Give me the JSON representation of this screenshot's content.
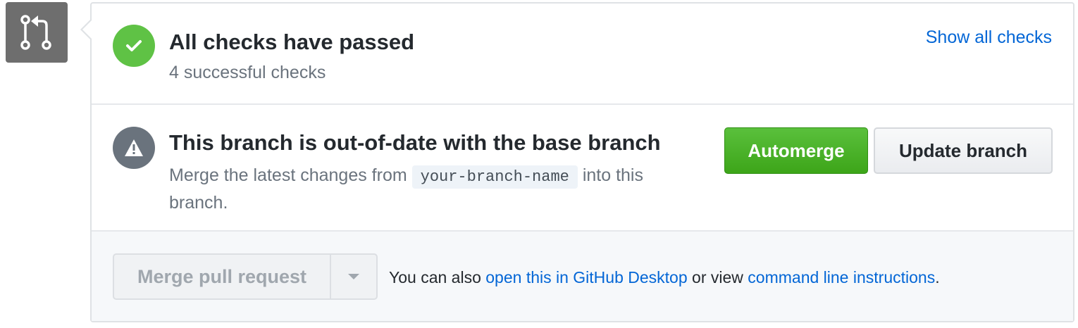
{
  "pr_icon": "git-pull-request-icon",
  "checks": {
    "icon": "check-icon",
    "title": "All checks have passed",
    "subtitle": "4 successful checks",
    "show_all": "Show all checks"
  },
  "branch": {
    "icon": "alert-icon",
    "title": "This branch is out-of-date with the base branch",
    "desc_prefix": "Merge the latest changes from",
    "branch_name": "your-branch-name",
    "desc_suffix": "into this",
    "desc_line2": "branch.",
    "automerge_label": "Automerge",
    "update_label": "Update branch"
  },
  "merge": {
    "button_label": "Merge pull request",
    "dropdown_icon": "triangle-down-icon",
    "text_prefix": "You can also",
    "desktop_link": "open this in GitHub Desktop",
    "text_middle": "or view",
    "cli_link": "command line instructions",
    "text_suffix": "."
  },
  "colors": {
    "success": "#5fc245",
    "automerge": "#3da519",
    "link": "#0366d6",
    "warning": "#6a737d"
  }
}
